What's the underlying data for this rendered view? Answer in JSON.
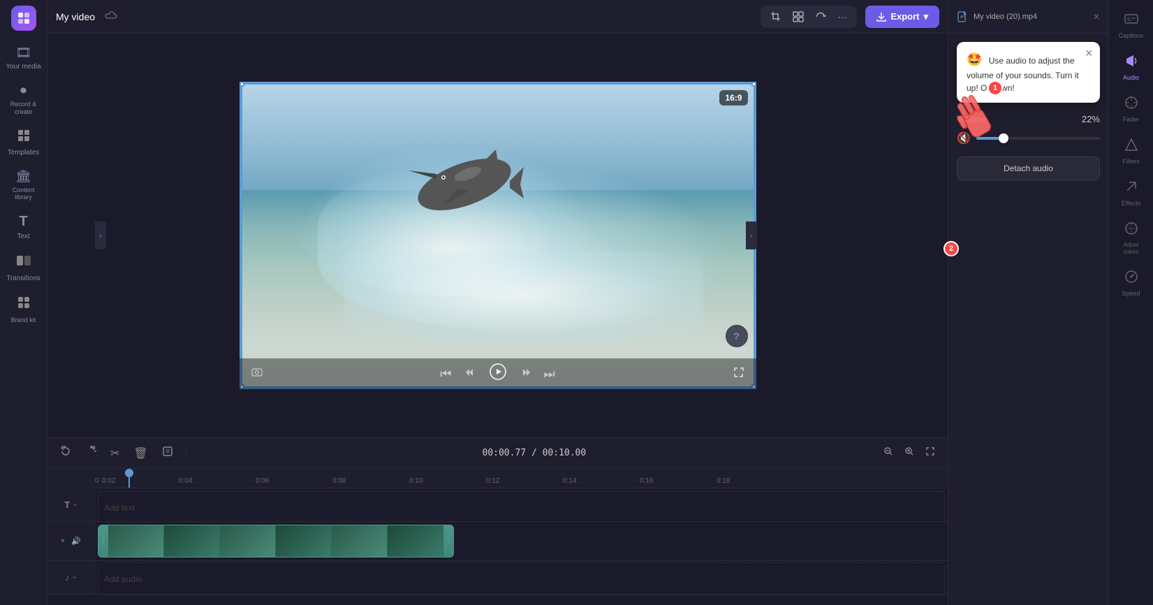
{
  "app": {
    "title": "My video",
    "logo_icon": "✦"
  },
  "sidebar": {
    "items": [
      {
        "id": "your-media",
        "label": "Your media",
        "icon": "🎞"
      },
      {
        "id": "record",
        "label": "Record &\ncreate",
        "icon": "⏺"
      },
      {
        "id": "templates",
        "label": "Templates",
        "icon": "⊞"
      },
      {
        "id": "content-library",
        "label": "Content\nlibrary",
        "icon": "🏛"
      },
      {
        "id": "text",
        "label": "Text",
        "icon": "T"
      },
      {
        "id": "transitions",
        "label": "Transitions",
        "icon": "⧉"
      },
      {
        "id": "brand",
        "label": "Brand kit",
        "icon": "◈"
      }
    ]
  },
  "toolbar": {
    "crop_icon": "⊡",
    "layout_icon": "⊞",
    "rotate_icon": "↺",
    "more_icon": "···",
    "export_label": "Export"
  },
  "preview": {
    "aspect_ratio": "16:9",
    "time_current": "00:00.77",
    "time_total": "00:10.00",
    "time_display": "00:00.77 / 00:10.00"
  },
  "audio_tooltip": {
    "emoji": "🤩",
    "text": "Use audio to adjust the volume of your sounds. Turn it up! Or down!"
  },
  "volume": {
    "label": "Volume",
    "value": "22%",
    "percentage": 22
  },
  "detach_audio": {
    "label": "Detach audio"
  },
  "right_panel": {
    "title": "My video (20).mp4"
  },
  "right_icons": [
    {
      "id": "captions",
      "label": "Captions",
      "icon": "⊟"
    },
    {
      "id": "audio",
      "label": "Audio",
      "icon": "🔊",
      "active": true
    },
    {
      "id": "fader",
      "label": "Fader",
      "icon": "⊘"
    },
    {
      "id": "filters",
      "label": "Filters",
      "icon": "⬡"
    },
    {
      "id": "effects",
      "label": "Effects",
      "icon": "✎"
    },
    {
      "id": "adjust-colors",
      "label": "Adjust\ncolors",
      "icon": "⊙"
    },
    {
      "id": "speed",
      "label": "Speed",
      "icon": "⊙"
    }
  ],
  "timeline": {
    "time_display": "00:00.77 / 00:10.00",
    "ruler_marks": [
      "0",
      "0:02",
      "0:04",
      "0:06",
      "0:08",
      "0:10",
      "0:12",
      "0:14",
      "0:16",
      "0:18"
    ],
    "text_track_label": "Add text",
    "audio_track_label": "Add audio"
  }
}
